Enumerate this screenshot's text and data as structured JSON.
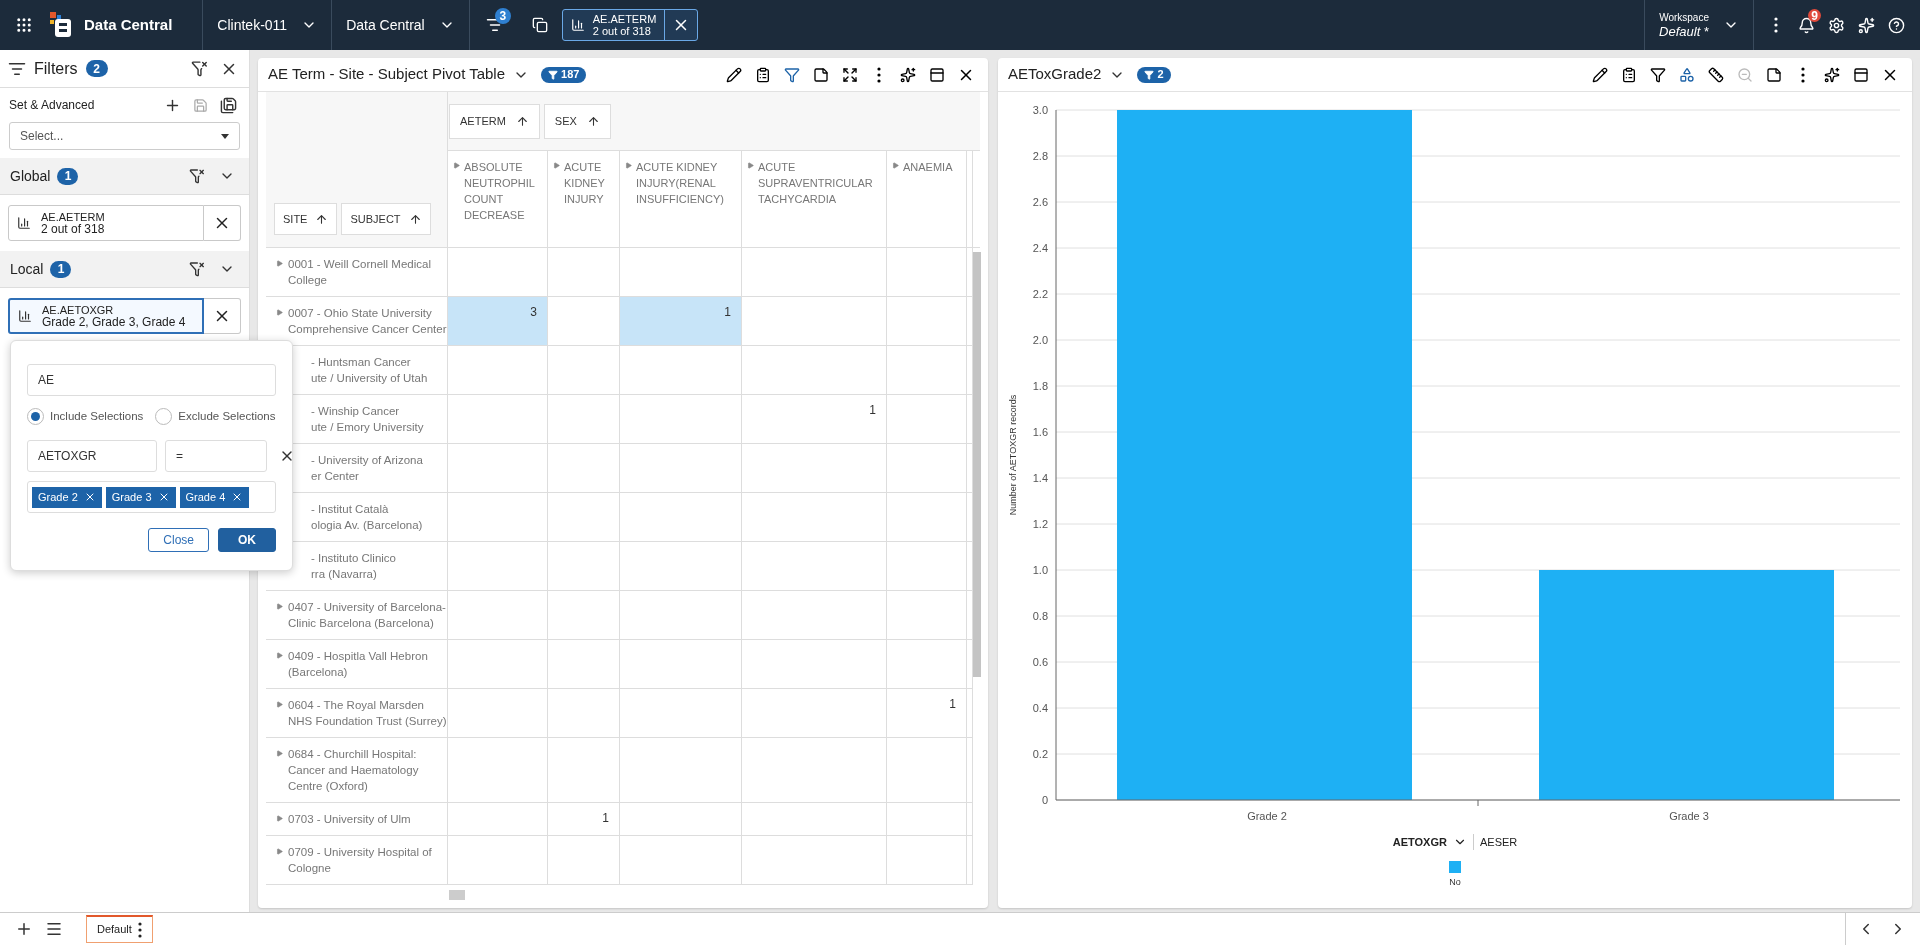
{
  "top_bar": {
    "app_title": "Data Central",
    "project": "Clintek-011",
    "module": "Data Central",
    "filter_badge": "3",
    "filter_chip": {
      "field": "AE.AETERM",
      "summary": "2 out of 318"
    },
    "workspace": {
      "label": "Workspace",
      "name": "Default",
      "modified": "*"
    },
    "notification_badge": "9"
  },
  "filters_panel": {
    "title": "Filters",
    "count": "2",
    "set_label": "Set & Advanced",
    "set_select": {
      "placeholder": "Select..."
    },
    "sections": [
      {
        "title": "Global",
        "count": "1",
        "chips": [
          {
            "field": "AE.AETERM",
            "summary": "2 out of 318",
            "selected": false
          }
        ]
      },
      {
        "title": "Local",
        "count": "1",
        "chips": [
          {
            "field": "AE.AETOXGR",
            "summary": "Grade 2, Grade 3, Grade 4",
            "selected": true
          }
        ]
      }
    ]
  },
  "filter_popover": {
    "search_value": "AE",
    "options": [
      {
        "label": "Include Selections",
        "selected": true
      },
      {
        "label": "Exclude Selections",
        "selected": false
      }
    ],
    "field": "AETOXGR",
    "operator": "=",
    "tags": [
      "Grade 2",
      "Grade 3",
      "Grade 4"
    ],
    "buttons": [
      {
        "label": "Close",
        "kind": "secondary"
      },
      {
        "label": "OK",
        "kind": "primary"
      }
    ]
  },
  "pivot": {
    "title": "AE Term - Site - Subject Pivot Table",
    "badge": "187",
    "column_fields": [
      "AETERM",
      "SEX"
    ],
    "row_fields": [
      "SITE",
      "SUBJECT"
    ],
    "columns": [
      "ABSOLUTE NEUTROPHIL COUNT DECREASE",
      "ACUTE KIDNEY INJURY",
      "ACUTE KIDNEY INJURY(RENAL INSUFFICIENCY)",
      "ACUTE SUPRAVENTRICULAR TACHYCARDIA",
      "ANAEMIA"
    ],
    "rows": [
      {
        "lines": [
          "0001 - Weill Cornell Medical",
          "College"
        ],
        "covered": false,
        "cells": [
          null,
          null,
          null,
          null,
          null
        ]
      },
      {
        "lines": [
          "0007 - Ohio State University",
          "Comprehensive Cancer Center"
        ],
        "covered": false,
        "cells": [
          {
            "value": "3",
            "selected": true
          },
          null,
          {
            "value": "1",
            "selected": true
          },
          null,
          null
        ]
      },
      {
        "lines": [
          "- Huntsman Cancer",
          "ute / University of Utah"
        ],
        "covered": true,
        "cells": [
          null,
          null,
          null,
          null,
          null
        ]
      },
      {
        "lines": [
          "- Winship Cancer",
          "ute / Emory University"
        ],
        "covered": true,
        "cells": [
          null,
          null,
          null,
          {
            "value": "1",
            "selected": false
          },
          null
        ]
      },
      {
        "lines": [
          "- University of Arizona",
          "er Center"
        ],
        "covered": true,
        "cells": [
          null,
          null,
          null,
          null,
          null
        ]
      },
      {
        "lines": [
          "- Institut Català",
          "ologia Av. (Barcelona)"
        ],
        "covered": true,
        "cells": [
          null,
          null,
          null,
          null,
          null
        ]
      },
      {
        "lines": [
          "- Instituto Clinico",
          "rra (Navarra)"
        ],
        "covered": true,
        "cells": [
          null,
          null,
          null,
          null,
          null
        ]
      },
      {
        "lines": [
          "0407 - University of Barcelona-",
          "Clinic Barcelona (Barcelona)"
        ],
        "covered": false,
        "cells": [
          null,
          null,
          null,
          null,
          null
        ]
      },
      {
        "lines": [
          "0409 - Hospitla Vall Hebron",
          "(Barcelona)"
        ],
        "covered": false,
        "cells": [
          null,
          null,
          null,
          null,
          null
        ]
      },
      {
        "lines": [
          "0604 - The Royal Marsden",
          "NHS Foundation Trust (Surrey)"
        ],
        "covered": false,
        "cells": [
          null,
          null,
          null,
          null,
          {
            "value": "1",
            "selected": false
          }
        ]
      },
      {
        "lines": [
          "0684 - Churchill Hospital:",
          "Cancer and Haematology",
          "Centre (Oxford)"
        ],
        "covered": false,
        "cells": [
          null,
          null,
          null,
          null,
          null
        ]
      },
      {
        "lines": [
          "0703 - University of Ulm"
        ],
        "covered": false,
        "cells": [
          null,
          {
            "value": "1",
            "selected": false
          },
          null,
          null,
          null
        ]
      },
      {
        "lines": [
          "0709 - University Hospital of",
          "Cologne"
        ],
        "covered": false,
        "cells": [
          null,
          null,
          null,
          null,
          null
        ]
      }
    ]
  },
  "chart_panel": {
    "title": "AEToxGrade2",
    "badge": "2",
    "chart_data": {
      "type": "bar",
      "grid": true,
      "ylabel": "Number of AETOXGR records",
      "categories": [
        "Grade 2",
        "Grade 3"
      ],
      "series": [
        {
          "name": "No",
          "color": "#1eb0f4",
          "values": [
            3,
            1
          ]
        }
      ],
      "ylim": [
        0,
        3
      ],
      "yticks": [
        0,
        {
          "value": 0.2,
          "label": "0.2"
        },
        {
          "value": 0.4,
          "label": "0.4"
        },
        {
          "value": 0.6,
          "label": "0.6"
        },
        {
          "value": 0.8,
          "label": "0.8"
        },
        {
          "value": 1,
          "label": "1.0"
        },
        {
          "value": 1.2,
          "label": "1.2"
        },
        {
          "value": 1.4,
          "label": "1.4"
        },
        {
          "value": 1.6,
          "label": "1.6"
        },
        {
          "value": 1.8,
          "label": "1.8"
        },
        {
          "value": 2,
          "label": "2.0"
        },
        {
          "value": 2.2,
          "label": "2.2"
        },
        {
          "value": 2.4,
          "label": "2.4"
        },
        {
          "value": 2.6,
          "label": "2.6"
        },
        {
          "value": 2.8,
          "label": "2.8"
        },
        {
          "value": 3,
          "label": "3.0"
        }
      ]
    },
    "axis_fields": [
      {
        "label": "AETOXGR",
        "selected": true
      },
      {
        "label": "AESER",
        "selected": false
      }
    ]
  },
  "bottom_bar": {
    "tabs": [
      {
        "label": "Default",
        "selected": true
      }
    ]
  }
}
